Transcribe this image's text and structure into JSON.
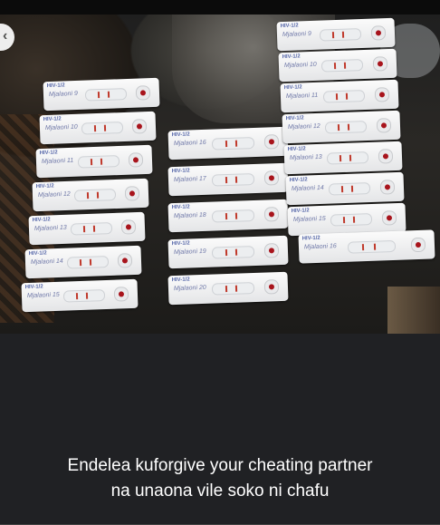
{
  "caption": {
    "line1": "Endelea kuforgive your cheating partner",
    "line2": "na unaona vile soko ni chafu"
  },
  "photo": {
    "subject": "hiv-test-cassettes",
    "cassette_brand_text": "HIV-1/2",
    "handwritten_labels": [
      "Mjalaoni 9",
      "Mjalaoni 10",
      "Mjalaoni 11",
      "Mjalaoni 12",
      "Mjalaoni 13",
      "Mjalaoni 14",
      "Mjalaoni 15",
      "Mjalaoni 16",
      "Mjalaoni 17",
      "Mjalaoni 18",
      "Mjalaoni 19",
      "Mjalaoni 20"
    ]
  },
  "colors": {
    "background": "#202124",
    "caption_text": "#ffffff",
    "test_line": "#c0392b",
    "sample_drop": "#a8141c"
  },
  "icons": {
    "back": "chevron-left-icon"
  }
}
